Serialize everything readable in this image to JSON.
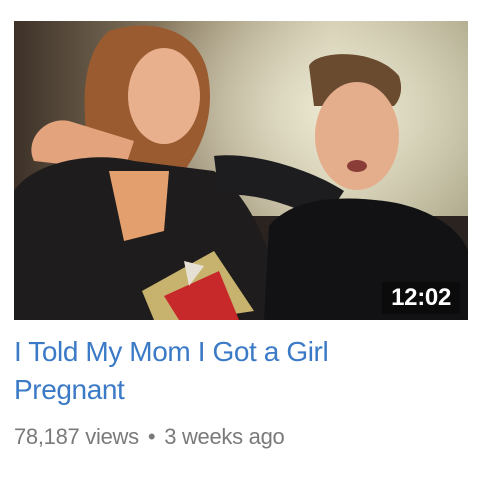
{
  "video": {
    "duration": "12:02",
    "title": "I Told My Mom I Got a Girl Pregnant",
    "views": "78,187 views",
    "separator": "•",
    "uploaded": "3 weeks ago"
  },
  "colors": {
    "title": "#3b7ac6",
    "meta": "#7a7a7a",
    "duration_bg": "#0a0a0a"
  }
}
